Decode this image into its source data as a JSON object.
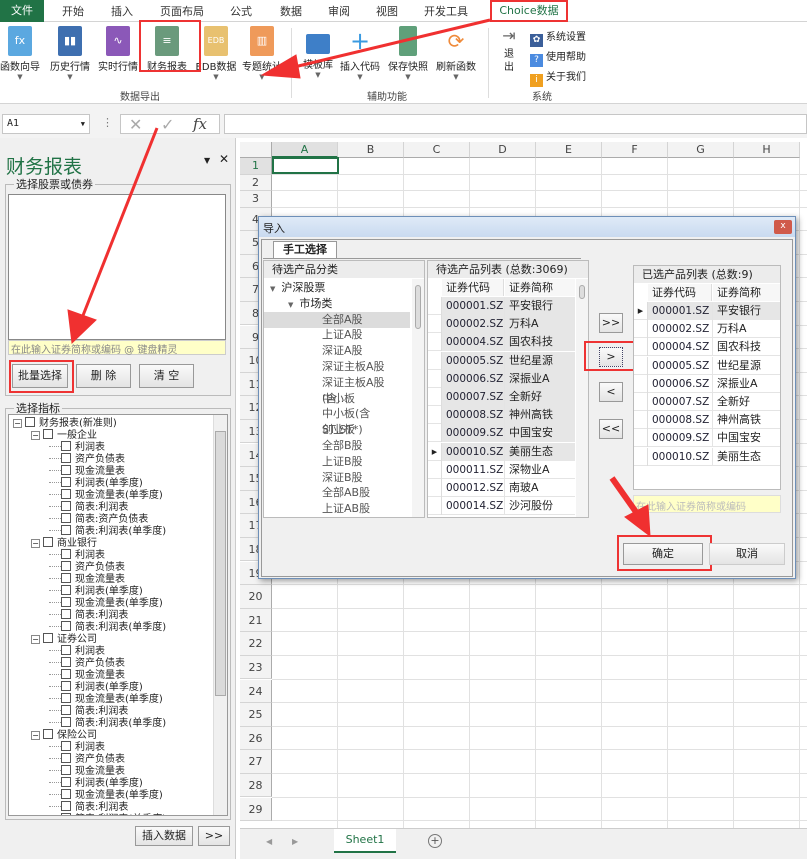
{
  "tabs": {
    "file": "文件",
    "items": [
      "开始",
      "插入",
      "页面布局",
      "公式",
      "数据",
      "审阅",
      "视图",
      "开发工具"
    ],
    "active": "Choice数据"
  },
  "ribbon": {
    "export_buttons": [
      "函数向导",
      "历史行情",
      "实时行情",
      "财务报表",
      "EDB数据",
      "专题统计"
    ],
    "export_group": "数据导出",
    "aux_buttons": [
      "模板库",
      "插入代码",
      "保存快照",
      "刷新函数"
    ],
    "aux_group": "辅助功能",
    "exit": "退出",
    "sys_items": [
      "系统设置",
      "使用帮助",
      "关于我们"
    ],
    "sys_group": "系统"
  },
  "formula_bar": {
    "name_box": "A1",
    "fx": "fx",
    "value": ""
  },
  "pane": {
    "title": "财务报表",
    "stock_group": "选择股票或债券",
    "input_placeholder": "在此输入证券简称或编码 @ 键盘精灵",
    "buttons": [
      "批量选择",
      "删 除",
      "清 空"
    ],
    "indicator_group": "选择指标",
    "tree": [
      {
        "label": "财务报表(新准则)",
        "level": 0
      },
      {
        "label": "一般企业",
        "level": 1
      },
      {
        "label": "利润表",
        "level": 2
      },
      {
        "label": "资产负债表",
        "level": 2
      },
      {
        "label": "现金流量表",
        "level": 2
      },
      {
        "label": "利润表(单季度)",
        "level": 2
      },
      {
        "label": "现金流量表(单季度)",
        "level": 2
      },
      {
        "label": "简表:利润表",
        "level": 2
      },
      {
        "label": "简表:资产负债表",
        "level": 2
      },
      {
        "label": "简表:利润表(单季度)",
        "level": 2
      },
      {
        "label": "商业银行",
        "level": 1
      },
      {
        "label": "利润表",
        "level": 2
      },
      {
        "label": "资产负债表",
        "level": 2
      },
      {
        "label": "现金流量表",
        "level": 2
      },
      {
        "label": "利润表(单季度)",
        "level": 2
      },
      {
        "label": "现金流量表(单季度)",
        "level": 2
      },
      {
        "label": "简表:利润表",
        "level": 2
      },
      {
        "label": "简表:利润表(单季度)",
        "level": 2
      },
      {
        "label": "证券公司",
        "level": 1
      },
      {
        "label": "利润表",
        "level": 2
      },
      {
        "label": "资产负债表",
        "level": 2
      },
      {
        "label": "现金流量表",
        "level": 2
      },
      {
        "label": "利润表(单季度)",
        "level": 2
      },
      {
        "label": "现金流量表(单季度)",
        "level": 2
      },
      {
        "label": "简表:利润表",
        "level": 2
      },
      {
        "label": "简表:利润表(单季度)",
        "level": 2
      },
      {
        "label": "保险公司",
        "level": 1
      },
      {
        "label": "利润表",
        "level": 2
      },
      {
        "label": "资产负债表",
        "level": 2
      },
      {
        "label": "现金流量表",
        "level": 2
      },
      {
        "label": "利润表(单季度)",
        "level": 2
      },
      {
        "label": "现金流量表(单季度)",
        "level": 2
      },
      {
        "label": "简表:利润表",
        "level": 2
      },
      {
        "label": "简表:利润表(单季度)",
        "level": 2
      }
    ],
    "insert_button": "插入数据",
    "more_button": ">>"
  },
  "sheet": {
    "columns": [
      "A",
      "B",
      "C",
      "D",
      "E",
      "F",
      "G",
      "H"
    ],
    "row_count": 29,
    "active_tab": "Sheet1",
    "add": "+"
  },
  "dialog": {
    "title": "导入",
    "close": "x",
    "tab": "手工选择",
    "category_header": "待选产品分类",
    "categories": [
      {
        "label": "沪深股票",
        "level": 0
      },
      {
        "label": "市场类",
        "level": 1
      },
      {
        "label": "全部A股",
        "level": 2,
        "selected": true
      },
      {
        "label": "上证A股",
        "level": 2
      },
      {
        "label": "深证A股",
        "level": 2
      },
      {
        "label": "深证主板A股",
        "level": 2
      },
      {
        "label": "深证主板A股(含...",
        "level": 2
      },
      {
        "label": "中小板",
        "level": 2
      },
      {
        "label": "中小板(含ST,ST*)",
        "level": 2
      },
      {
        "label": "创业板",
        "level": 2
      },
      {
        "label": "全部B股",
        "level": 2
      },
      {
        "label": "上证B股",
        "level": 2
      },
      {
        "label": "深证B股",
        "level": 2
      },
      {
        "label": "全部AB股",
        "level": 2
      },
      {
        "label": "上证AB股",
        "level": 2
      }
    ],
    "candidates_header": "待选产品列表 (总数:3069)",
    "col_code": "证券代码",
    "col_name": "证券简称",
    "candidates": [
      [
        "000001.SZ",
        "平安银行"
      ],
      [
        "000002.SZ",
        "万科A"
      ],
      [
        "000004.SZ",
        "国农科技"
      ],
      [
        "000005.SZ",
        "世纪星源"
      ],
      [
        "000006.SZ",
        "深振业A"
      ],
      [
        "000007.SZ",
        "全新好"
      ],
      [
        "000008.SZ",
        "神州高铁"
      ],
      [
        "000009.SZ",
        "中国宝安"
      ],
      [
        "000010.SZ",
        "美丽生态"
      ],
      [
        "000011.SZ",
        "深物业A"
      ],
      [
        "000012.SZ",
        "南玻A"
      ],
      [
        "000014.SZ",
        "沙河股份"
      ]
    ],
    "selected_header": "已选产品列表 (总数:9)",
    "selected": [
      [
        "000001.SZ",
        "平安银行"
      ],
      [
        "000002.SZ",
        "万科A"
      ],
      [
        "000004.SZ",
        "国农科技"
      ],
      [
        "000005.SZ",
        "世纪星源"
      ],
      [
        "000006.SZ",
        "深振业A"
      ],
      [
        "000007.SZ",
        "全新好"
      ],
      [
        "000008.SZ",
        "神州高铁"
      ],
      [
        "000009.SZ",
        "中国宝安"
      ],
      [
        "000010.SZ",
        "美丽生态"
      ]
    ],
    "move_buttons": [
      ">>",
      ">",
      "<",
      "<<"
    ],
    "search_placeholder": "在此输入证券简称或编码",
    "ok": "确定",
    "cancel": "取消"
  },
  "colors": {
    "excel_green": "#217346",
    "annotation_red": "#e33",
    "input_yellow": "#ffffc8"
  }
}
